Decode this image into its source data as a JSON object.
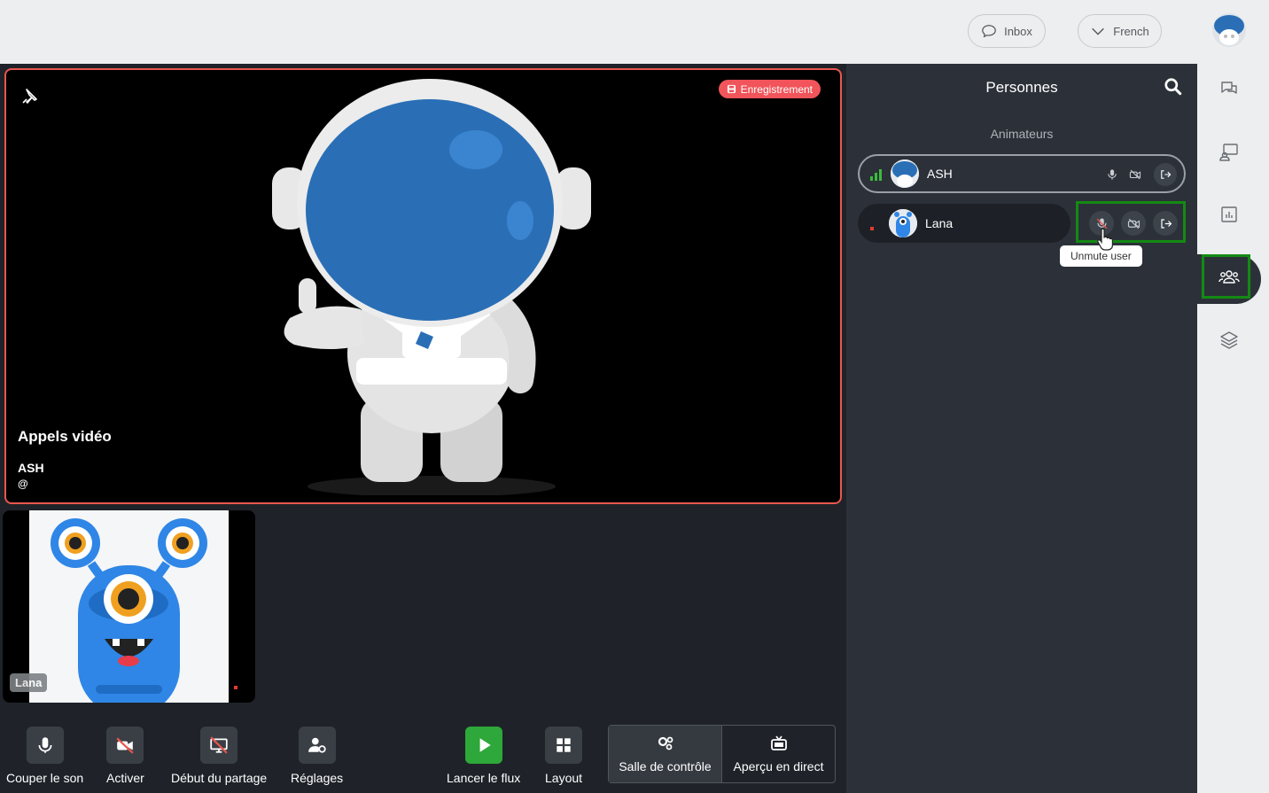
{
  "topbar": {
    "inbox_label": "Inbox",
    "language_label": "French"
  },
  "main_video": {
    "recording_label": "Enregistrement",
    "title": "Appels vidéo",
    "presenter_name": "ASH",
    "presenter_handle": "@"
  },
  "thumbnail": {
    "name": "Lana"
  },
  "toolbar": {
    "mute_label": "Couper le son",
    "activate_label": "Activer",
    "share_label": "Début du partage",
    "settings_label": "Réglages",
    "stream_label": "Lancer le flux",
    "layout_label": "Layout",
    "control_room_label": "Salle de contrôle",
    "live_preview_label": "Aperçu en direct"
  },
  "people_panel": {
    "title": "Personnes",
    "section_title": "Animateurs",
    "participants": [
      {
        "name": "ASH"
      },
      {
        "name": "Lana"
      }
    ],
    "tooltip": "Unmute user"
  },
  "rail": {
    "icons": [
      "chat-icon",
      "presentation-icon",
      "poll-icon",
      "people-icon",
      "layers-icon"
    ],
    "active": "people-icon"
  },
  "colors": {
    "recording": "#f1545a",
    "highlight": "#138a13",
    "stream_button": "#2ea83a",
    "panel_bg": "#2c3139",
    "stage_bg": "#1f2329"
  }
}
